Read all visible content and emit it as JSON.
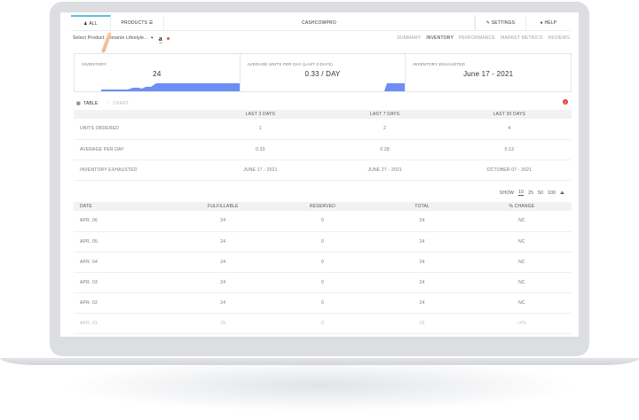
{
  "topnav": {
    "all_label": "ALL",
    "products_label": "PRODUCTS",
    "app_title": "CASHCOWPRO",
    "settings_label": "SETTINGS",
    "help_label": "HELP"
  },
  "subbar": {
    "select_label": "Select Product:",
    "product_value": "lonanie Lifestyle...",
    "marketplace": "a",
    "tabs": [
      {
        "label": "SUMMARY",
        "active": false
      },
      {
        "label": "INVENTORY",
        "active": true
      },
      {
        "label": "PERFORMANCE",
        "active": false
      },
      {
        "label": "MARKET METRICS",
        "active": false
      },
      {
        "label": "REVIEWS",
        "active": false
      }
    ]
  },
  "metrics": [
    {
      "label": "INVENTORY",
      "value": "24"
    },
    {
      "label": "AVERAGE UNITS PER DAY (LAST 3 DAYS)",
      "value": "0.33 / DAY"
    },
    {
      "label": "INVENTORY EXHAUSTED",
      "value": "June 17 - 2021"
    }
  ],
  "view_toggle": {
    "table_label": "TABLE",
    "chart_label": "CHART"
  },
  "summary_table": {
    "headers": [
      "",
      "LAST 3 DAYS",
      "LAST 7 DAYS",
      "LAST 30 DAYS"
    ],
    "rows": [
      [
        "UNITS ORDERED",
        "1",
        "2",
        "4"
      ],
      [
        "AVERAGE PER DAY",
        "0.33",
        "0.28",
        "0.13"
      ],
      [
        "INVENTORY EXHAUSTED",
        "JUNE 17 - 2021",
        "JUNE 27 - 2021",
        "OCTOBER 07 - 2021"
      ]
    ]
  },
  "pager": {
    "show_label": "SHOW",
    "options": [
      "10",
      "25",
      "50",
      "100"
    ],
    "selected": "10"
  },
  "daily_table": {
    "headers": [
      "DATE",
      "FULFILLABLE",
      "RESERVED",
      "TOTAL",
      "% CHANGE"
    ],
    "rows": [
      [
        "APR. 06",
        "24",
        "0",
        "24",
        "NC"
      ],
      [
        "APR. 05",
        "24",
        "0",
        "24",
        "NC"
      ],
      [
        "APR. 04",
        "24",
        "0",
        "24",
        "NC"
      ],
      [
        "APR. 03",
        "24",
        "0",
        "24",
        "NC"
      ],
      [
        "APR. 02",
        "24",
        "0",
        "24",
        "NC"
      ],
      [
        "APR. 01",
        "25",
        "0",
        "25",
        "+4%"
      ]
    ]
  },
  "colors": {
    "accent": "#6c8ef5",
    "top_accent": "#5bc0de",
    "help_red": "#e0413a"
  }
}
